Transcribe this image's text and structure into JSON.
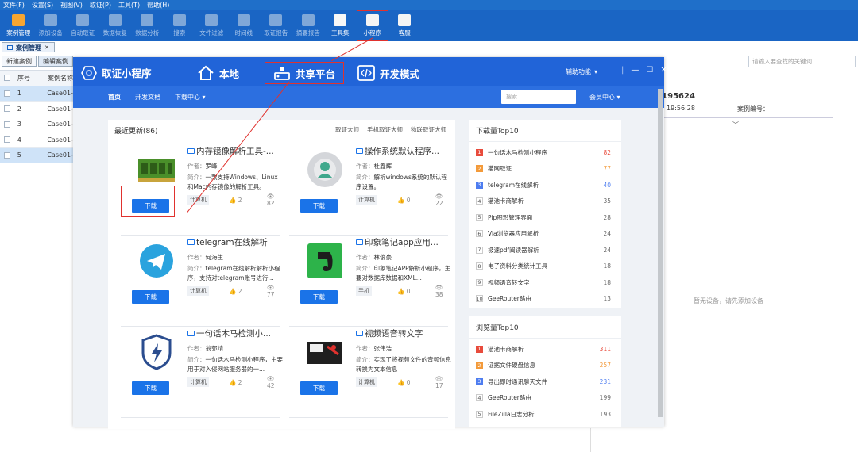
{
  "menubar": [
    "文件(F)",
    "设置(S)",
    "视图(V)",
    "取证(P)",
    "工具(T)",
    "帮助(H)"
  ],
  "toolbar": [
    {
      "label": "案例管理",
      "icon": "folder-icon",
      "on": true
    },
    {
      "label": "添加设备",
      "icon": "add-device-icon"
    },
    {
      "label": "自动取证",
      "icon": "monitor-icon"
    },
    {
      "label": "数据恢复",
      "icon": "recover-icon"
    },
    {
      "label": "数据分析",
      "icon": "analysis-icon"
    },
    {
      "label": "搜索",
      "icon": "search-doc-icon"
    },
    {
      "label": "文件过滤",
      "icon": "filter-icon"
    },
    {
      "label": "时间线",
      "icon": "timeline-icon"
    },
    {
      "label": "取证报告",
      "icon": "report-icon"
    },
    {
      "label": "摘要报告",
      "icon": "summary-icon"
    },
    {
      "label": "工具集",
      "icon": "toolkit-icon",
      "on": true
    },
    {
      "label": "小程序",
      "icon": "miniprogram-icon",
      "on": true,
      "hl": true
    },
    {
      "label": "客服",
      "icon": "service-icon",
      "on": true
    }
  ],
  "doc_tab": "案例管理",
  "left": {
    "new_case": "新建案例",
    "edit_case": "编辑案例",
    "col_no": "序号",
    "col_name": "案例名称",
    "rows": [
      {
        "no": "1",
        "name": "Case01-"
      },
      {
        "no": "2",
        "name": "Case01-"
      },
      {
        "no": "3",
        "name": "Case01-"
      },
      {
        "no": "4",
        "name": "Case01-"
      },
      {
        "no": "5",
        "name": "Case01-"
      }
    ]
  },
  "right": {
    "search_placeholder": "请输入要查找的关键词",
    "case_id": "-195624",
    "time": "19:56:28",
    "case_no_label": "案例编号：",
    "no_device": "暂无设备，请先添加设备"
  },
  "mini": {
    "title": "取证小程序",
    "nav": [
      "本地",
      "共享平台",
      "开发模式"
    ],
    "assist": "辅助功能",
    "sub": [
      "首页",
      "开发文档",
      "下载中心 ▾"
    ],
    "search_placeholder": "搜索",
    "member": "会员中心 ▾",
    "latest": "最近更新(86)",
    "latest_links": [
      "取证大师",
      "手机取证大师",
      "物联取证大师"
    ],
    "download_label": "下载",
    "author_label": "作者：",
    "desc_label": "简介：",
    "cards": [
      {
        "title": "内存镜像解析工具-...",
        "author": "罗峰",
        "desc": "一款支持Windows、Linux和Mac内存镜像的解析工具。",
        "tag": "计算机",
        "likes": "2",
        "views": "82",
        "img": "memory"
      },
      {
        "title": "操作系统默认程序...",
        "author": "杜鑫辉",
        "desc": "解析windows系统的默认程序设置。",
        "tag": "计算机",
        "likes": "0",
        "views": "22",
        "img": "gear"
      },
      {
        "title": "telegram在线解析",
        "author": "何海生",
        "desc": "telegram在线解析解析小程序，支持对telegram账号进行...",
        "tag": "计算机",
        "likes": "2",
        "views": "77",
        "img": "telegram"
      },
      {
        "title": "印象笔记app应用...",
        "author": "林俊豪",
        "desc": "印象笔记APP解析小程序，主要对数据库数据和XML...",
        "tag": "手机",
        "likes": "0",
        "views": "38",
        "img": "evernote"
      },
      {
        "title": "一句话木马检测小...",
        "author": "翁郭靖",
        "desc": "一句话木马检测小程序，主要用于对入侵网站服务器的一...",
        "tag": "计算机",
        "likes": "2",
        "views": "42",
        "img": "shield"
      },
      {
        "title": "视频语音转文字",
        "author": "张伟浩",
        "desc": "实现了将视频文件的音频信息转换为文本信息",
        "tag": "计算机",
        "likes": "0",
        "views": "17",
        "img": "video"
      }
    ],
    "dl_top_title": "下载量Top10",
    "dl_top": [
      {
        "n": "1",
        "t": "一句话木马检测小程序",
        "v": "82"
      },
      {
        "n": "2",
        "t": "猫网取证",
        "v": "77"
      },
      {
        "n": "3",
        "t": "telegram在线解析",
        "v": "40"
      },
      {
        "n": "4",
        "t": "猫池卡商解析",
        "v": "35"
      },
      {
        "n": "5",
        "t": "Pip图形管理界面",
        "v": "28"
      },
      {
        "n": "6",
        "t": "Via浏览器应用解析",
        "v": "24"
      },
      {
        "n": "7",
        "t": "极速pdf阅读器解析",
        "v": "24"
      },
      {
        "n": "8",
        "t": "电子资料分类统计工具",
        "v": "18"
      },
      {
        "n": "9",
        "t": "视频语音转文字",
        "v": "18"
      },
      {
        "n": "10",
        "t": "GeeRouter路由",
        "v": "13"
      }
    ],
    "view_top_title": "浏览量Top10",
    "view_top": [
      {
        "n": "1",
        "t": "猫池卡商解析",
        "v": "311"
      },
      {
        "n": "2",
        "t": "证据文件硬盘信息",
        "v": "257"
      },
      {
        "n": "3",
        "t": "导出即时通讯聊天文件",
        "v": "231"
      },
      {
        "n": "4",
        "t": "GeeRouter路由",
        "v": "199"
      },
      {
        "n": "5",
        "t": "FileZilla日志分析",
        "v": "193"
      }
    ]
  }
}
